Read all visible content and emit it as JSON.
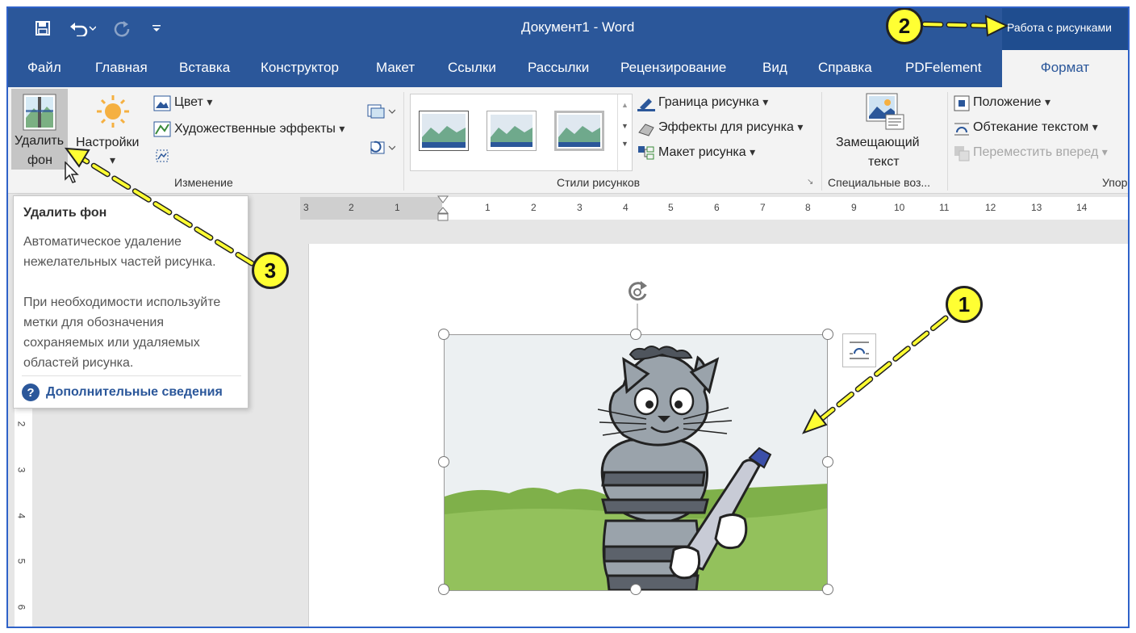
{
  "window": {
    "title": "Документ1  -  Word",
    "context_tab": "Работа с рисунками"
  },
  "tabs": [
    "Файл",
    "Главная",
    "Вставка",
    "Конструктор",
    "Макет",
    "Ссылки",
    "Рассылки",
    "Рецензирование",
    "Вид",
    "Справка",
    "PDFelement"
  ],
  "active_tab": "Формат",
  "ribbon": {
    "remove_bg": {
      "line1": "Удалить",
      "line2": "фон"
    },
    "settings": "Настройки",
    "color": "Цвет",
    "artistic_effects": "Художественные эффекты",
    "group_change": "Изменение",
    "picture_border": "Граница рисунка",
    "picture_effects": "Эффекты для рисунка",
    "picture_layout": "Макет рисунка",
    "group_styles": "Стили рисунков",
    "alt_text": {
      "line1": "Замещающий",
      "line2": "текст"
    },
    "group_special": "Специальные воз...",
    "position": "Положение",
    "wrap_text": "Обтекание текстом",
    "bring_forward": "Переместить вперед",
    "group_arrange": "Упор"
  },
  "ruler": {
    "h_numbers": [
      "3",
      "2",
      "1",
      "1",
      "1",
      "2",
      "3",
      "4",
      "5",
      "6",
      "7",
      "8",
      "9",
      "10",
      "11",
      "12",
      "13",
      "14"
    ],
    "v_numbers": [
      "2",
      "3",
      "4",
      "5",
      "6"
    ]
  },
  "tooltip": {
    "title": "Удалить фон",
    "para1": "Автоматическое удаление нежелательных частей рисунка.",
    "para2": "При необходимости используйте метки для обозначения сохраняемых или удаляемых областей рисунка.",
    "more": "Дополнительные сведения"
  },
  "callouts": [
    "1",
    "2",
    "3"
  ],
  "colors": {
    "title_bar": "#2b579a",
    "context_tab": "#1f4d8f",
    "callout_fill": "#ffff33"
  }
}
